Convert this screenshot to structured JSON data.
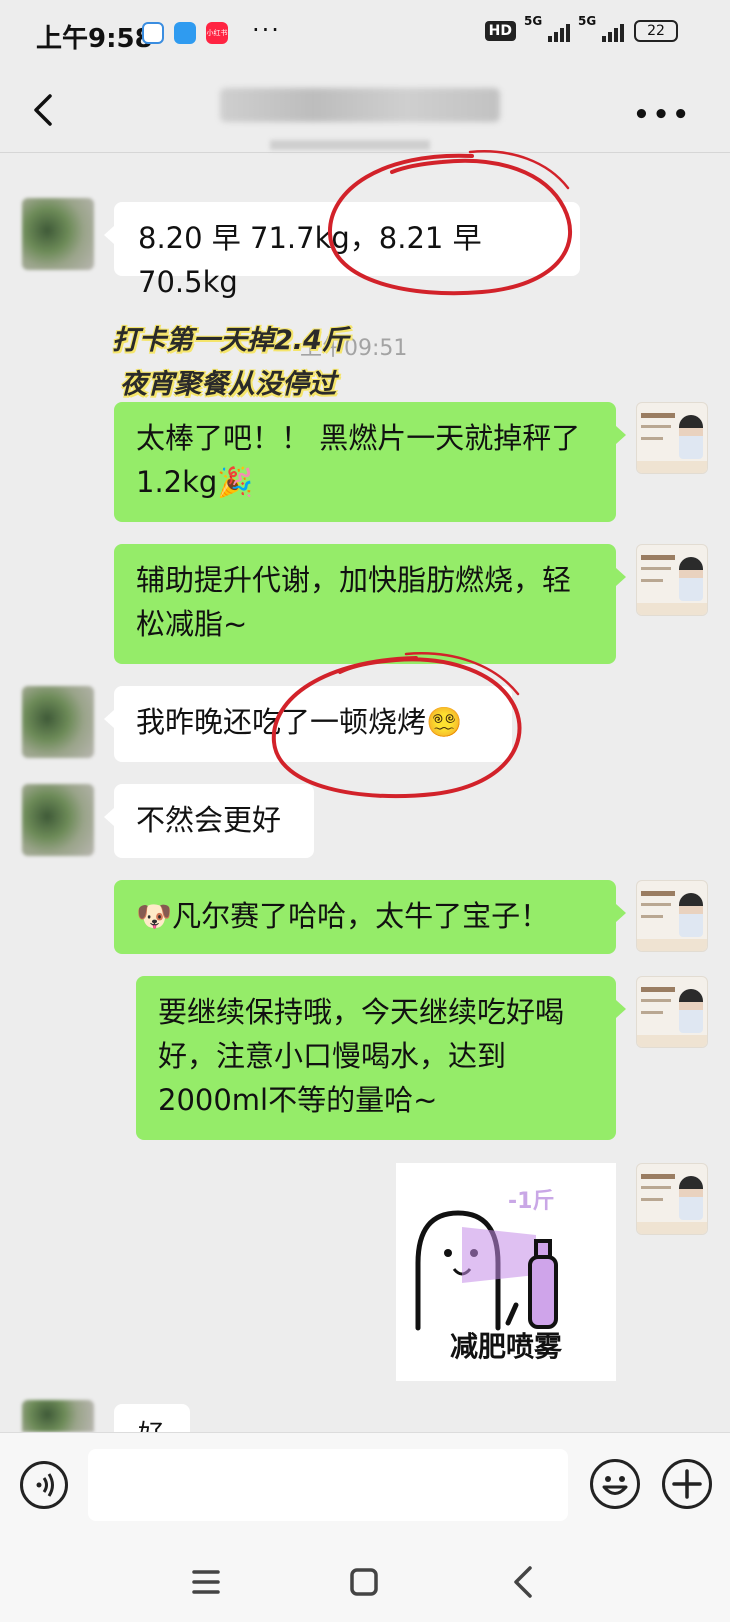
{
  "status_bar": {
    "time": "上午9:58",
    "app_icons": [
      "qq-icon",
      "browser-icon",
      "xiaohongshu-icon"
    ],
    "xiaohongshu_label": "小红书",
    "hd_label": "HD",
    "network_1": "5G",
    "network_2": "5G",
    "battery": "22"
  },
  "header": {
    "title": "",
    "more_label": "•••"
  },
  "messages": [
    {
      "side": "left",
      "text": "8.20 早 71.7kg，8.21 早 70.5kg"
    },
    {
      "side": "right",
      "text": "太棒了吧！！ 黑燃片一天就掉秤了1.2kg🎉"
    },
    {
      "side": "right",
      "text": "辅助提升代谢，加快脂肪燃烧，轻松减脂~"
    },
    {
      "side": "left",
      "text": "我昨晚还吃了一顿烧烤😵‍💫"
    },
    {
      "side": "left",
      "text": "不然会更好"
    },
    {
      "side": "right",
      "text": "🐶凡尔赛了哈哈，太牛了宝子！"
    },
    {
      "side": "right",
      "text": "要继续保持哦，今天继续吃好喝好，注意小口慢喝水，达到2000ml不等的量哈~"
    },
    {
      "side": "left",
      "text": "好"
    }
  ],
  "timestamp": "上午09:51",
  "overlay_captions": [
    "打卡第一天掉2.4斤",
    "夜宵聚餐从没停过"
  ],
  "sticker": {
    "top_text": "-1斤",
    "caption": "减肥喷雾"
  },
  "input_bar": {
    "placeholder": ""
  },
  "colors": {
    "bubble_green": "#95ec69",
    "bubble_white": "#ffffff",
    "background": "#ededed",
    "annotation_red": "#d2222a",
    "caption_highlight": "#f5e56b"
  }
}
